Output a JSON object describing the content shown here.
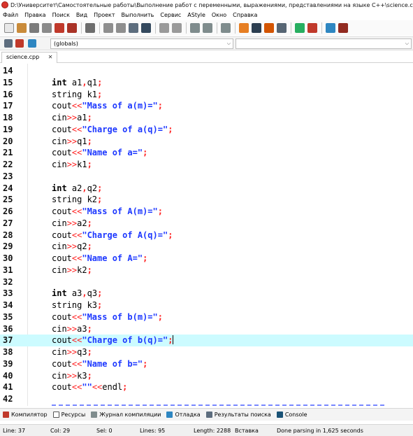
{
  "window": {
    "title": "D:\\Университет\\Самостоятельные работы\\Выполнение работ с переменными, выражениями, представлениями на языке C++\\science.cpp - En"
  },
  "menu": [
    "Файл",
    "Правка",
    "Поиск",
    "Вид",
    "Проект",
    "Выполнить",
    "Сервис",
    "AStyle",
    "Окно",
    "Справка"
  ],
  "toolbar_icons": [
    {
      "name": "new-file-icon",
      "color": "#e8e8e8"
    },
    {
      "name": "open-file-icon",
      "color": "#c98b3a"
    },
    {
      "name": "save-icon",
      "color": "#7a7a7a"
    },
    {
      "name": "save-all-icon",
      "color": "#8a8a8a"
    },
    {
      "name": "close-file-icon",
      "color": "#c0392b"
    },
    {
      "name": "close-all-icon",
      "color": "#a93226"
    },
    {
      "name": "print-icon",
      "color": "#6d6d6d"
    },
    {
      "name": "find-icon",
      "color": "#8e8e8e"
    },
    {
      "name": "replace-icon",
      "color": "#8e8e8e"
    },
    {
      "name": "goto-icon",
      "color": "#5d6d7e"
    },
    {
      "name": "bookmark-icon",
      "color": "#34495e"
    },
    {
      "name": "undo-icon",
      "color": "#9a9a9a"
    },
    {
      "name": "redo-icon",
      "color": "#9a9a9a"
    },
    {
      "name": "indent-icon",
      "color": "#7f8c8d"
    },
    {
      "name": "unindent-icon",
      "color": "#7f8c8d"
    },
    {
      "name": "toggle-comment-icon",
      "color": "#7f8c8d"
    },
    {
      "name": "compile-icon",
      "color": "#e67e22"
    },
    {
      "name": "run-icon",
      "color": "#2c3e50"
    },
    {
      "name": "compile-run-icon",
      "color": "#d35400"
    },
    {
      "name": "rebuild-icon",
      "color": "#566573"
    },
    {
      "name": "check-syntax-icon",
      "color": "#27ae60"
    },
    {
      "name": "stop-icon",
      "color": "#c0392b"
    },
    {
      "name": "chart-icon",
      "color": "#2e86c1"
    },
    {
      "name": "project-icon",
      "color": "#922b21"
    }
  ],
  "scope": {
    "class_combo": "",
    "func_combo": "(globals)"
  },
  "editor_tab": {
    "label": "science.cpp",
    "close": "✕"
  },
  "lines": [
    {
      "n": "14",
      "tokens": []
    },
    {
      "n": "15",
      "tokens": [
        [
          "kw",
          "int"
        ],
        [
          "id",
          " a1"
        ],
        [
          "pn",
          ","
        ],
        [
          "id",
          "q1"
        ],
        [
          "pn",
          ";"
        ]
      ]
    },
    {
      "n": "16",
      "tokens": [
        [
          "id",
          "string k1"
        ],
        [
          "pn",
          ";"
        ]
      ]
    },
    {
      "n": "17",
      "tokens": [
        [
          "id",
          "cout"
        ],
        [
          "op",
          "<<"
        ],
        [
          "str",
          "\"Mass of a(m)=\""
        ],
        [
          "pn",
          ";"
        ]
      ]
    },
    {
      "n": "18",
      "tokens": [
        [
          "id",
          "cin"
        ],
        [
          "op",
          ">>"
        ],
        [
          "id",
          "a1"
        ],
        [
          "pn",
          ";"
        ]
      ]
    },
    {
      "n": "19",
      "tokens": [
        [
          "id",
          "cout"
        ],
        [
          "op",
          "<<"
        ],
        [
          "str",
          "\"Charge of a(q)=\""
        ],
        [
          "pn",
          ";"
        ]
      ]
    },
    {
      "n": "20",
      "tokens": [
        [
          "id",
          "cin"
        ],
        [
          "op",
          ">>"
        ],
        [
          "id",
          "q1"
        ],
        [
          "pn",
          ";"
        ]
      ]
    },
    {
      "n": "21",
      "tokens": [
        [
          "id",
          "cout"
        ],
        [
          "op",
          "<<"
        ],
        [
          "str",
          "\"Name of a=\""
        ],
        [
          "pn",
          ";"
        ]
      ]
    },
    {
      "n": "22",
      "tokens": [
        [
          "id",
          "cin"
        ],
        [
          "op",
          ">>"
        ],
        [
          "id",
          "k1"
        ],
        [
          "pn",
          ";"
        ]
      ]
    },
    {
      "n": "23",
      "tokens": []
    },
    {
      "n": "24",
      "tokens": [
        [
          "kw",
          "int"
        ],
        [
          "id",
          " a2"
        ],
        [
          "pn",
          ","
        ],
        [
          "id",
          "q2"
        ],
        [
          "pn",
          ";"
        ]
      ]
    },
    {
      "n": "25",
      "tokens": [
        [
          "id",
          "string k2"
        ],
        [
          "pn",
          ";"
        ]
      ]
    },
    {
      "n": "26",
      "tokens": [
        [
          "id",
          "cout"
        ],
        [
          "op",
          "<<"
        ],
        [
          "str",
          "\"Mass of A(m)=\""
        ],
        [
          "pn",
          ";"
        ]
      ]
    },
    {
      "n": "27",
      "tokens": [
        [
          "id",
          "cin"
        ],
        [
          "op",
          ">>"
        ],
        [
          "id",
          "a2"
        ],
        [
          "pn",
          ";"
        ]
      ]
    },
    {
      "n": "28",
      "tokens": [
        [
          "id",
          "cout"
        ],
        [
          "op",
          "<<"
        ],
        [
          "str",
          "\"Charge of A(q)=\""
        ],
        [
          "pn",
          ";"
        ]
      ]
    },
    {
      "n": "29",
      "tokens": [
        [
          "id",
          "cin"
        ],
        [
          "op",
          ">>"
        ],
        [
          "id",
          "q2"
        ],
        [
          "pn",
          ";"
        ]
      ]
    },
    {
      "n": "30",
      "tokens": [
        [
          "id",
          "cout"
        ],
        [
          "op",
          "<<"
        ],
        [
          "str",
          "\"Name of A=\""
        ],
        [
          "pn",
          ";"
        ]
      ]
    },
    {
      "n": "31",
      "tokens": [
        [
          "id",
          "cin"
        ],
        [
          "op",
          ">>"
        ],
        [
          "id",
          "k2"
        ],
        [
          "pn",
          ";"
        ]
      ]
    },
    {
      "n": "32",
      "tokens": []
    },
    {
      "n": "33",
      "tokens": [
        [
          "kw",
          "int"
        ],
        [
          "id",
          " a3"
        ],
        [
          "pn",
          ","
        ],
        [
          "id",
          "q3"
        ],
        [
          "pn",
          ";"
        ]
      ]
    },
    {
      "n": "34",
      "tokens": [
        [
          "id",
          "string k3"
        ],
        [
          "pn",
          ";"
        ]
      ]
    },
    {
      "n": "35",
      "tokens": [
        [
          "id",
          "cout"
        ],
        [
          "op",
          "<<"
        ],
        [
          "str",
          "\"Mass of b(m)=\""
        ],
        [
          "pn",
          ";"
        ]
      ]
    },
    {
      "n": "36",
      "tokens": [
        [
          "id",
          "cin"
        ],
        [
          "op",
          ">>"
        ],
        [
          "id",
          "a3"
        ],
        [
          "pn",
          ";"
        ]
      ]
    },
    {
      "n": "37",
      "current": true,
      "tokens": [
        [
          "id",
          "cout"
        ],
        [
          "op",
          "<<"
        ],
        [
          "str",
          "\"Charge of b(q)=\""
        ],
        [
          "pn",
          ";"
        ]
      ]
    },
    {
      "n": "38",
      "tokens": [
        [
          "id",
          "cin"
        ],
        [
          "op",
          ">>"
        ],
        [
          "id",
          "q3"
        ],
        [
          "pn",
          ";"
        ]
      ]
    },
    {
      "n": "39",
      "tokens": [
        [
          "id",
          "cout"
        ],
        [
          "op",
          "<<"
        ],
        [
          "str",
          "\"Name of b=\""
        ],
        [
          "pn",
          ";"
        ]
      ]
    },
    {
      "n": "40",
      "tokens": [
        [
          "id",
          "cin"
        ],
        [
          "op",
          ">>"
        ],
        [
          "id",
          "k3"
        ],
        [
          "pn",
          ";"
        ]
      ]
    },
    {
      "n": "41",
      "tokens": [
        [
          "id",
          "cout"
        ],
        [
          "op",
          "<<"
        ],
        [
          "str",
          "\"\""
        ],
        [
          "op",
          "<<"
        ],
        [
          "id",
          "endl"
        ],
        [
          "pn",
          ";"
        ]
      ]
    },
    {
      "n": "42",
      "tokens": []
    }
  ],
  "bottom_tabs": [
    {
      "label": "Компилятор",
      "icon": "compiler-icon",
      "color": "#c0392b"
    },
    {
      "label": "Ресурсы",
      "icon": "resources-icon",
      "color": "#ffffff"
    },
    {
      "label": "Журнал компиляции",
      "icon": "compile-log-icon",
      "color": "#7f8c8d"
    },
    {
      "label": "Отладка",
      "icon": "debug-icon",
      "color": "#2e86c1"
    },
    {
      "label": "Результаты поиска",
      "icon": "search-results-icon",
      "color": "#5d6d7e"
    },
    {
      "label": "Console",
      "icon": "console-icon",
      "color": "#1a5276"
    }
  ],
  "status": {
    "line_label": "Line:",
    "line": "37",
    "col_label": "Col:",
    "col": "29",
    "sel_label": "Sel:",
    "sel": "0",
    "lines_label": "Lines:",
    "lines": "95",
    "length_label": "Length:",
    "length": "2288",
    "mode": "Вставка",
    "message": "Done parsing in 1,625 seconds"
  }
}
